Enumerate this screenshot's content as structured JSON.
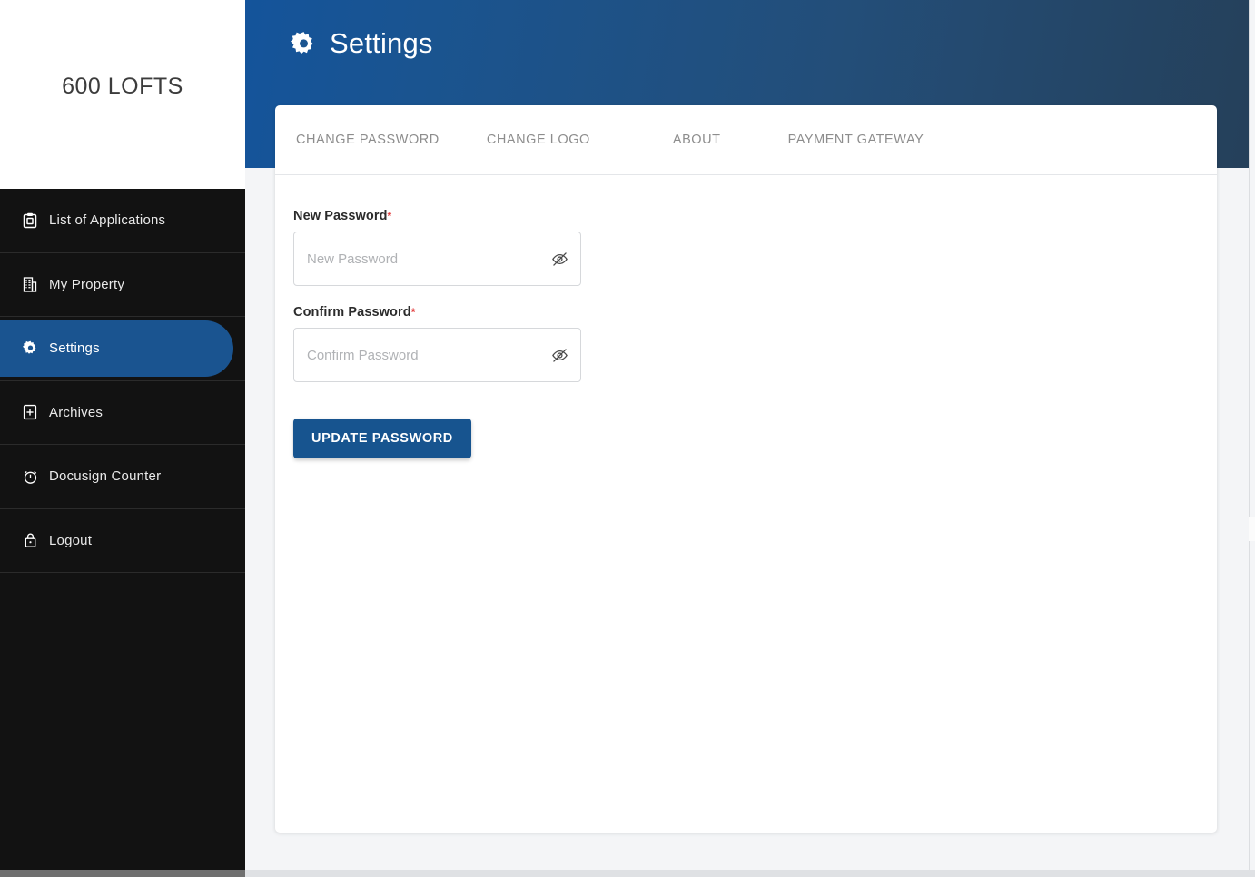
{
  "brand": {
    "name": "600 LOFTS"
  },
  "sidebar": {
    "items": [
      {
        "label": "List of Applications",
        "icon": "clipboard-icon",
        "active": false
      },
      {
        "label": "My Property",
        "icon": "building-icon",
        "active": false
      },
      {
        "label": "Settings",
        "icon": "gear-icon",
        "active": true
      },
      {
        "label": "Archives",
        "icon": "archive-icon",
        "active": false
      },
      {
        "label": "Docusign Counter",
        "icon": "stopwatch-icon",
        "active": false
      },
      {
        "label": "Logout",
        "icon": "lock-icon",
        "active": false
      }
    ]
  },
  "header": {
    "title": "Settings",
    "icon": "gear-icon",
    "gradient_from": "#14549b",
    "gradient_to": "#25405a"
  },
  "tabs": [
    {
      "label": "CHANGE PASSWORD",
      "active": false
    },
    {
      "label": "CHANGE LOGO",
      "active": false
    },
    {
      "label": "ABOUT",
      "active": false
    },
    {
      "label": "PAYMENT GATEWAY",
      "active": false
    }
  ],
  "form": {
    "fields": [
      {
        "label": "New Password",
        "required_marker": "*",
        "value": "",
        "placeholder": "New Password",
        "toggle_icon": "eye-slash-icon"
      },
      {
        "label": "Confirm Password",
        "required_marker": "*",
        "value": "",
        "placeholder": "Confirm Password",
        "toggle_icon": "eye-slash-icon"
      }
    ],
    "submit_label": "UPDATE PASSWORD",
    "submit_color": "#17548f"
  },
  "colors": {
    "sidebar_bg": "#121212",
    "active_pill": "#1a5490",
    "page_bg": "#f4f5f7",
    "required_red": "#e23b3b"
  }
}
